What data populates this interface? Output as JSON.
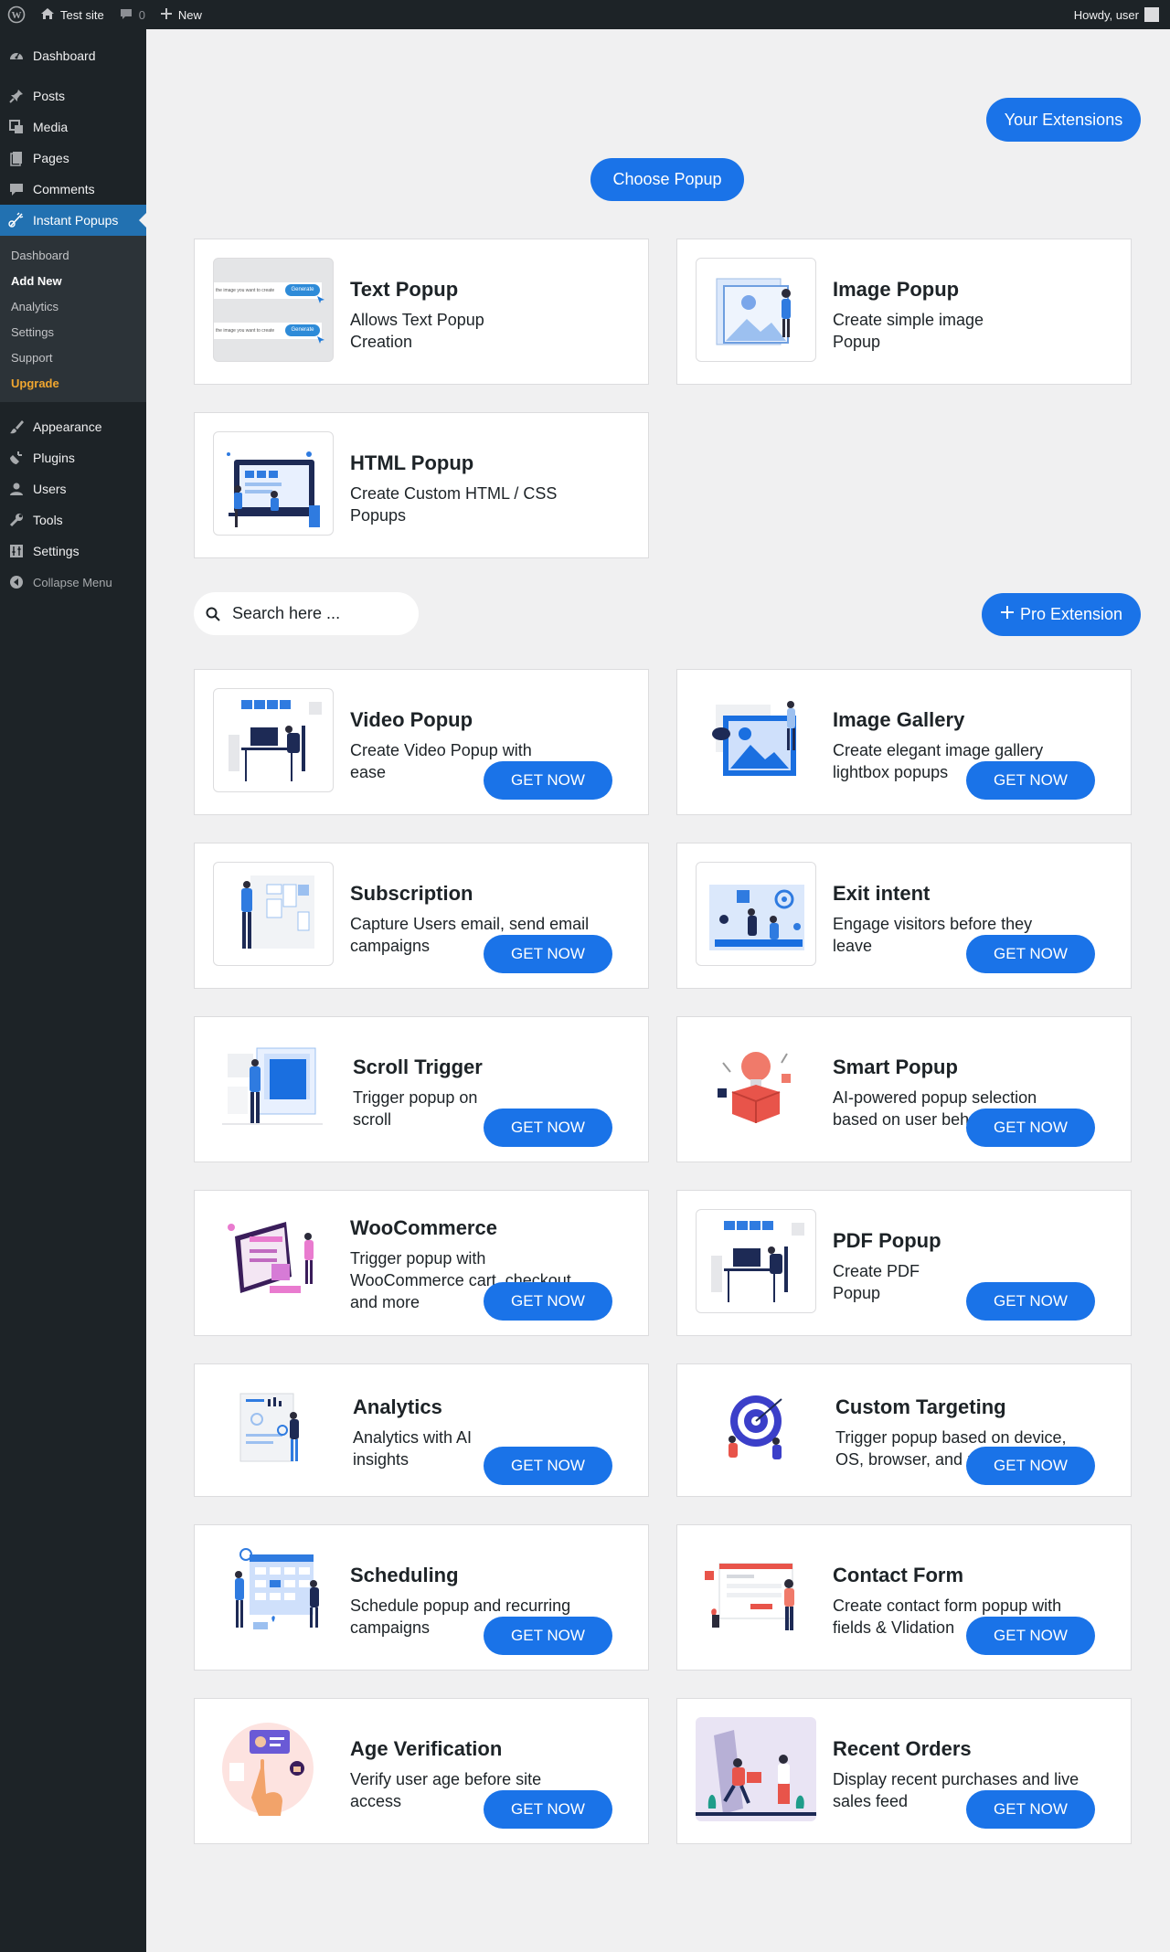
{
  "adminbar": {
    "site_name": "Test site",
    "comments_count": "0",
    "new_label": "New",
    "howdy": "Howdy, user"
  },
  "sidebar": {
    "dashboard": "Dashboard",
    "posts": "Posts",
    "media": "Media",
    "pages": "Pages",
    "comments": "Comments",
    "instant_popups": "Instant Popups",
    "submenu": [
      "Dashboard",
      "Add New",
      "Analytics",
      "Settings",
      "Support",
      "Upgrade"
    ],
    "appearance": "Appearance",
    "plugins": "Plugins",
    "users": "Users",
    "tools": "Tools",
    "settings": "Settings",
    "collapse": "Collapse Menu"
  },
  "main": {
    "your_extensions": "Your Extensions",
    "choose_popup": "Choose Popup",
    "pro_extension": "Pro Extension",
    "search_placeholder": "Search here ...",
    "get_now": "GET NOW",
    "basic_cards": [
      {
        "title": "Text Popup",
        "desc": "Allows Text Popup Creation"
      },
      {
        "title": "Image Popup",
        "desc": "Create simple image Popup"
      },
      {
        "title": "HTML Popup",
        "desc": "Create Custom HTML / CSS Popups"
      }
    ],
    "pro_cards": [
      {
        "title": "Video Popup",
        "desc": "Create Video Popup with ease"
      },
      {
        "title": "Image Gallery",
        "desc": "Create elegant image gallery lightbox popups"
      },
      {
        "title": "Subscription",
        "desc": "Capture Users email, send email campaigns"
      },
      {
        "title": "Exit intent",
        "desc": "Engage visitors before they leave"
      },
      {
        "title": "Scroll Trigger",
        "desc": "Trigger popup on scroll"
      },
      {
        "title": "Smart Popup",
        "desc": "AI-powered popup selection based on user behavior"
      },
      {
        "title": "WooCommerce",
        "desc": "Trigger popup with WooCommerce cart, checkout and more"
      },
      {
        "title": "PDF Popup",
        "desc": "Create PDF Popup"
      },
      {
        "title": "Analytics",
        "desc": "Analytics with AI insights"
      },
      {
        "title": "Custom Targeting",
        "desc": "Trigger popup based on device, OS, browser, and more"
      },
      {
        "title": "Scheduling",
        "desc": "Schedule popup and recurring campaigns"
      },
      {
        "title": "Contact Form",
        "desc": "Create contact form popup with fields & Vlidation"
      },
      {
        "title": "Age Verification",
        "desc": "Verify user age before site access"
      },
      {
        "title": "Recent Orders",
        "desc": "Display recent purchases and live sales feed"
      }
    ],
    "text_popup_thumb": {
      "input_text": "the image you want to create",
      "button": "Generate"
    }
  },
  "colors": {
    "accent": "#1a73e8",
    "admin_dark": "#1d2327",
    "menu_current": "#2271b1",
    "upgrade": "#f0a62f"
  }
}
